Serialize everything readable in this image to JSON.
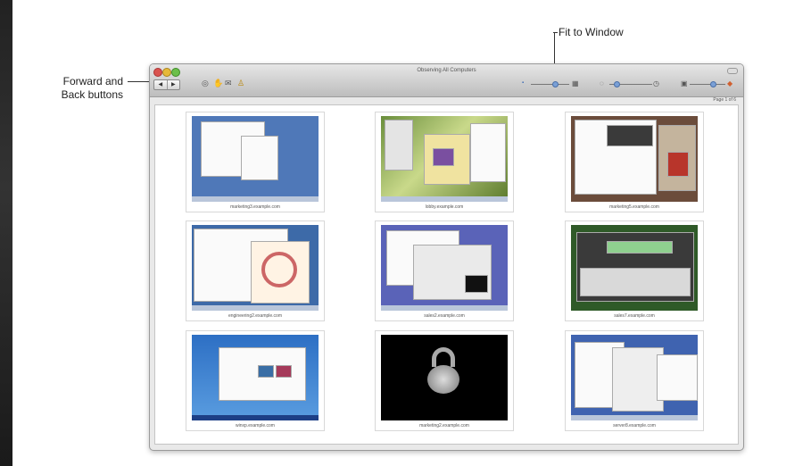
{
  "annotations": {
    "fit_to_window": "Fit to Window",
    "forward_back_line1": "Forward and",
    "forward_back_line2": "Back buttons"
  },
  "window": {
    "title": "Observing All Computers",
    "page_indicator": "Page 1 of 6"
  },
  "thumbnails": [
    {
      "label": "marketing3.example.com"
    },
    {
      "label": "lobby.example.com"
    },
    {
      "label": "marketing5.example.com"
    },
    {
      "label": "engineering2.example.com"
    },
    {
      "label": "sales2.example.com"
    },
    {
      "label": "sales7.example.com"
    },
    {
      "label": "winxp.example.com"
    },
    {
      "label": "marketing2.example.com"
    },
    {
      "label": "server8.example.com"
    }
  ]
}
